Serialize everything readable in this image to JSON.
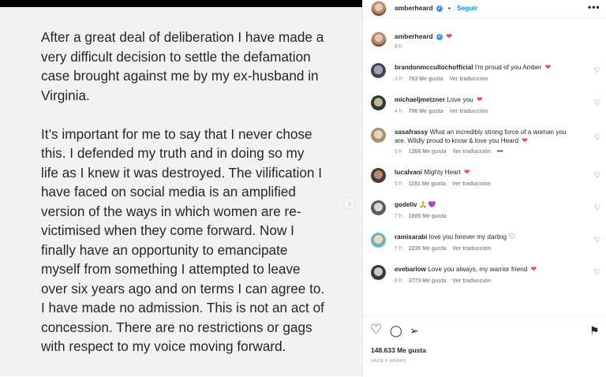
{
  "post": {
    "paragraphs": [
      "After a great deal of deliberation I have made a very difficult decision to settle the defamation case brought against me by my ex-husband in Virginia.",
      "It’s important for me to say that I never chose this. I defended my truth and in doing so my life as I knew it was destroyed. The vilification I have faced on social media is an amplified version of the ways in which women are re-victimised when they come forward.  Now I finally have an opportunity to emancipate myself from something I attempted to leave over six years ago and on terms I can agree to. I have made no admission. This is not an act of concession. There are no restrictions or gags with respect to my voice moving forward."
    ],
    "next_icon": "chevron-right-icon",
    "next_glyph": "›"
  },
  "header": {
    "username": "amberheard",
    "verified_glyph": "✓",
    "separator": "•",
    "follow_label": "Seguir",
    "more_glyph": "•••"
  },
  "caption": {
    "username": "amberheard",
    "verified_glyph": "✓",
    "emoji": "❤",
    "time": "8 h"
  },
  "comments": [
    {
      "username": "brandonmccullochofficial",
      "text": "I'm proud of you Amber ",
      "emoji": "❤",
      "time": "3 h",
      "likes": "763 Me gusta",
      "translate": "Ver traducción",
      "more": ""
    },
    {
      "username": "michaeljmetzner",
      "text": "Love you ",
      "emoji": "❤",
      "time": "4 h",
      "likes": "796 Me gusta",
      "translate": "Ver traducción",
      "more": ""
    },
    {
      "username": "sasafrassy",
      "text": "What an incredibly strong force of a woman you are. Wildly proud to know & love you Heard ",
      "emoji": "❤",
      "time": "5 h",
      "likes": "1368 Me gusta",
      "translate": "Ver traducción",
      "more": "•••"
    },
    {
      "username": "lucalvani",
      "text": "Mighty Heart ",
      "emoji": "❤",
      "time": "5 h",
      "likes": "1181 Me gusta",
      "translate": "Ver traducción",
      "more": ""
    },
    {
      "username": "godeliv",
      "text": "🙏",
      "emoji": "💜",
      "time": "7 h",
      "likes": "1605 Me gusta",
      "translate": "",
      "more": ""
    },
    {
      "username": "ramisarabi",
      "text": "love you forever my darling ",
      "emoji": "♡",
      "time": "7 h",
      "likes": "2235 Me gusta",
      "translate": "Ver traducción",
      "more": ""
    },
    {
      "username": "evebarlow",
      "text": "Love you always, my warrior friend ",
      "emoji": "❤",
      "time": "8 h",
      "likes": "3773 Me gusta",
      "translate": "Ver traducción",
      "more": ""
    }
  ],
  "comment_like_glyph": "♡",
  "actions": {
    "like_glyph": "♡",
    "comment_glyph": "◯",
    "share_glyph": "➢",
    "save_glyph": "⚑",
    "likes_total": "148.633 Me gusta",
    "post_time": "HACE 8 HORAS"
  },
  "colors": {
    "follow_blue": "#0095f6",
    "verified_blue": "#3897f0",
    "heart_red": "#ed4956",
    "post_background": "#f2f2f2"
  }
}
